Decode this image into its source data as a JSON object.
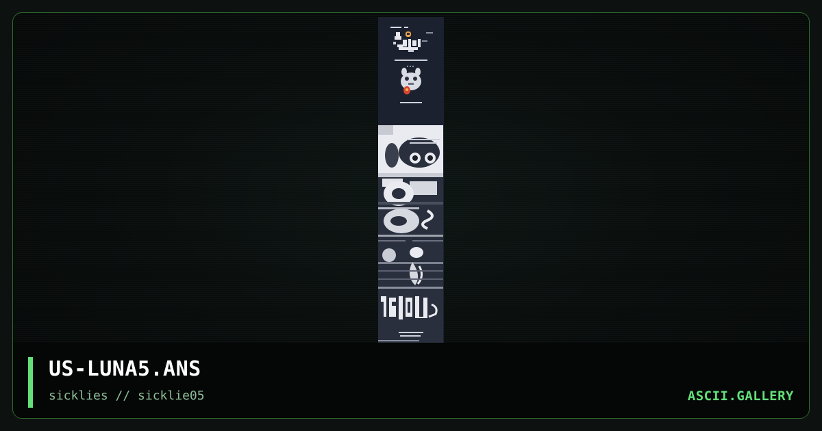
{
  "card": {
    "title": "US-LUNA5.ANS",
    "subtitle": "sicklies // sicklie05",
    "brand": "ASCII.GALLERY"
  },
  "colors": {
    "background": "#0d1210",
    "frame_border": "#2f6a2c",
    "accent": "#63e07a",
    "title_text": "#ffffff",
    "subtitle_text": "#8fbf98",
    "artwork_background": "#1d2230"
  },
  "artwork": {
    "description_icon": "ansi-artwork-thumbnail"
  }
}
